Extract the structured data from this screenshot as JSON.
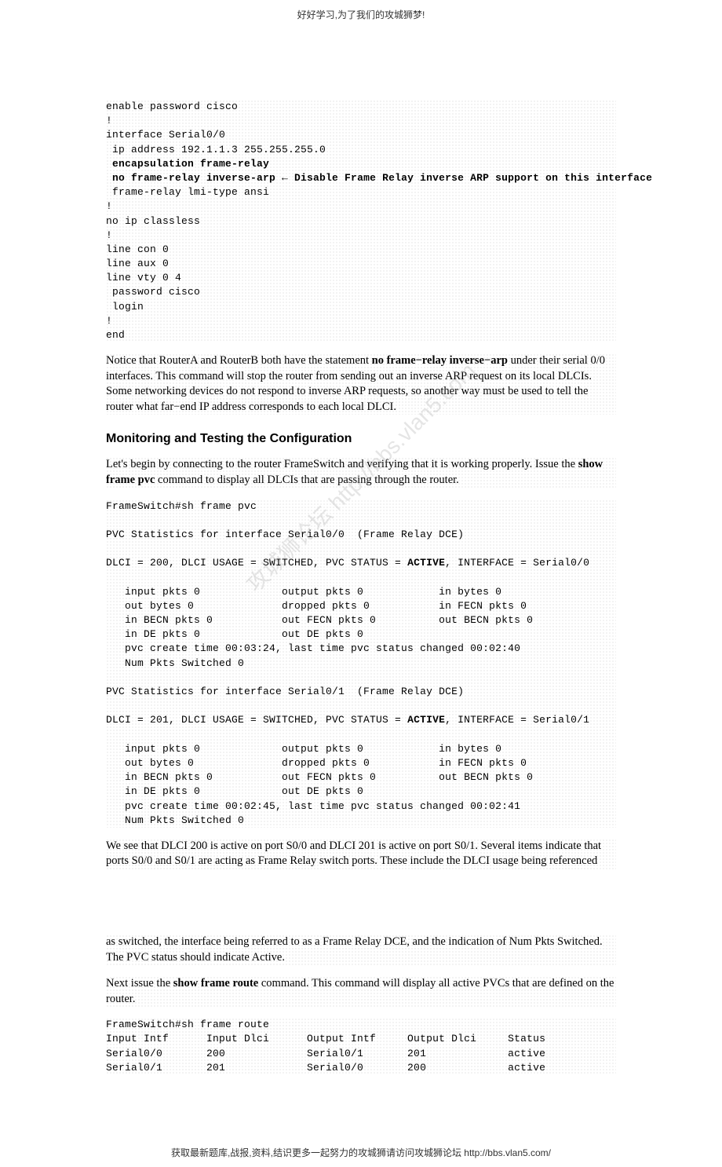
{
  "header_text": "好好学习,为了我们的攻城狮梦!",
  "code_block_1": {
    "l1": "enable password cisco",
    "l2": "!",
    "l3": "interface Serial0/0",
    "l4": " ip address 192.1.1.3 255.255.255.0",
    "l5": " encapsulation frame-relay",
    "l6a": " no frame-relay inverse-arp",
    "l6b": " ← Disable Frame Relay inverse ARP support on this interface",
    "l7": " frame-relay lmi-type ansi",
    "l8": "!",
    "l9": "no ip classless",
    "l10": "!",
    "l11": "line con 0",
    "l12": "line aux 0",
    "l13": "line vty 0 4",
    "l14": " password cisco",
    "l15": " login",
    "l16": "!",
    "l17": "end"
  },
  "para1_a": "Notice that RouterA and RouterB both have the statement ",
  "para1_bold": "no frame−relay inverse−arp",
  "para1_b": " under their serial 0/0 interfaces. This command will stop the router from sending out an inverse ARP request on its local DLCIs. Some networking devices do not respond to inverse ARP requests, so another way must be used to tell the router what far−end IP address corresponds to each local DLCI.",
  "section_title": "Monitoring and Testing the Configuration",
  "para2_a": "Let's begin by connecting to the router FrameSwitch and verifying that it is working properly. Issue the ",
  "para2_bold": "show frame pvc",
  "para2_b": " command to display all DLCIs that are passing through the router.",
  "code_block_2": {
    "l1": "FrameSwitch#sh frame pvc",
    "l2": "",
    "l3": "PVC Statistics for interface Serial0/0  (Frame Relay DCE)",
    "l4": "",
    "l5a": "DLCI = 200, DLCI USAGE = SWITCHED, PVC STATUS = ",
    "l5b": "ACTIVE",
    "l5c": ", INTERFACE = Serial0/0",
    "l6": "",
    "l7": "   input pkts 0             output pkts 0            in bytes 0",
    "l8": "   out bytes 0              dropped pkts 0           in FECN pkts 0",
    "l9": "   in BECN pkts 0           out FECN pkts 0          out BECN pkts 0",
    "l10": "   in DE pkts 0             out DE pkts 0",
    "l11": "   pvc create time 00:03:24, last time pvc status changed 00:02:40",
    "l12": "   Num Pkts Switched 0",
    "l13": "",
    "l14": "PVC Statistics for interface Serial0/1  (Frame Relay DCE)",
    "l15": "",
    "l16a": "DLCI = 201, DLCI USAGE = SWITCHED, PVC STATUS = ",
    "l16b": "ACTIVE",
    "l16c": ", INTERFACE = Serial0/1",
    "l17": "",
    "l18": "   input pkts 0             output pkts 0            in bytes 0",
    "l19": "   out bytes 0              dropped pkts 0           in FECN pkts 0",
    "l20": "   in BECN pkts 0           out FECN pkts 0          out BECN pkts 0",
    "l21": "   in DE pkts 0             out DE pkts 0",
    "l22": "   pvc create time 00:02:45, last time pvc status changed 00:02:41",
    "l23": "   Num Pkts Switched 0"
  },
  "para3": "We see that DLCI 200 is active on port S0/0 and DLCI 201 is active on port S0/1. Several items indicate that ports S0/0 and S0/1 are acting as Frame Relay switch ports. These include the DLCI usage being referenced",
  "para4": "as switched, the interface being referred to as a Frame Relay DCE, and the indication of Num Pkts Switched. The PVC status should indicate Active.",
  "para5_a": "Next issue the ",
  "para5_bold": "show frame route",
  "para5_b": " command. This command will display all active PVCs that are defined on the router.",
  "code_block_3": {
    "l1": "FrameSwitch#sh frame route",
    "l2": "Input Intf      Input Dlci      Output Intf     Output Dlci     Status",
    "l3": "Serial0/0       200             Serial0/1       201             active",
    "l4": "Serial0/1       201             Serial0/0       200             active"
  },
  "footer_text": "获取最新题库,战报,资料,结识更多一起努力的攻城狮请访问攻城狮论坛 http://bbs.vlan5.com/",
  "watermark_text": "攻城狮论坛 http://bbs.vlan5.com"
}
